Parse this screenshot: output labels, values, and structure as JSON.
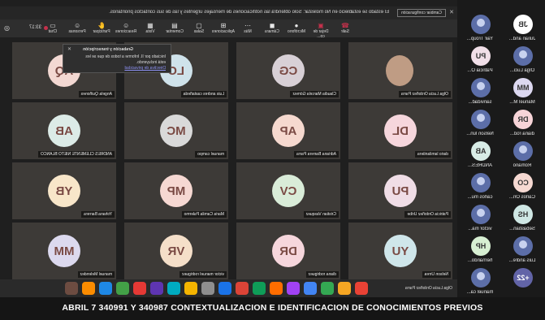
{
  "meeting": {
    "notice": "El estado se estableció en No molestar: Solo obtendrá las notificaciones de mensajes urgentes y las de sus contactos prioritarios.",
    "notice_button": "Cambiar configuración",
    "timer": "33:17"
  },
  "toolbar": {
    "items": [
      {
        "label": "Chat",
        "icon": "chat-icon"
      },
      {
        "label": "Personas",
        "icon": "people-icon"
      },
      {
        "label": "Participar",
        "icon": "raise-hand-icon"
      },
      {
        "label": "Reacciones",
        "icon": "reaction-icon"
      },
      {
        "label": "Vista",
        "icon": "view-icon"
      },
      {
        "label": "Comentar",
        "icon": "notes-icon"
      },
      {
        "label": "Salas",
        "icon": "rooms-icon"
      },
      {
        "label": "Aplicaciones",
        "icon": "apps-icon"
      },
      {
        "label": "Más",
        "icon": "more-icon"
      },
      {
        "label": "Cámara",
        "icon": "camera-icon"
      },
      {
        "label": "Micrófono",
        "icon": "microphone-icon"
      },
      {
        "label": "Dejar de co...",
        "icon": "share-stop-icon"
      },
      {
        "label": "Salir",
        "icon": "leave-icon"
      }
    ]
  },
  "popup": {
    "title": "Grabación y transcripción",
    "line1": "Iniciado por II. Informe a todos de que se les",
    "line2": "está incluyendo.",
    "link": "Directiva de privacidad"
  },
  "roster": [
    {
      "initials": "JB",
      "name": "Julian and..."
    },
    {
      "initials": "",
      "name": "Yair Troup..."
    },
    {
      "initials": "",
      "name": "Olga Luci..."
    },
    {
      "initials": "PU",
      "name": "Patricia O..."
    },
    {
      "initials": "MM",
      "name": "Manuel M..."
    },
    {
      "initials": "",
      "name": "sanvidad..."
    },
    {
      "initials": "DR",
      "name": "diana rod..."
    },
    {
      "initials": "",
      "name": "Nelson lun..."
    },
    {
      "initials": "",
      "name": "Romario"
    },
    {
      "initials": "AB",
      "name": "ANDRES..."
    },
    {
      "initials": "CO",
      "name": "Carlos Ori..."
    },
    {
      "initials": "",
      "name": "carlos mu..."
    },
    {
      "initials": "HS",
      "name": "Sebastian..."
    },
    {
      "initials": "",
      "name": "victor ma..."
    },
    {
      "initials": "",
      "name": "Luis andre..."
    },
    {
      "initials": "HP",
      "name": "hernando..."
    },
    {
      "initials": "+22",
      "name": ""
    },
    {
      "initials": "",
      "name": "manuel ca..."
    }
  ],
  "tiles": [
    {
      "initials": "",
      "name": "Olga Lucia Ordoñez Parra",
      "color": "#c9a28e",
      "photo": true
    },
    {
      "initials": "CG",
      "name": "Claudia Marcela Gómez",
      "color": "#d8d0d6"
    },
    {
      "initials": "LC",
      "name": "Luis andres castañeda",
      "color": "#cfe2ea"
    },
    {
      "initials": "AQ",
      "name": "Angela Quiñones",
      "color": "#f3d8d2"
    },
    {
      "initials": "DL",
      "name": "dario lamilantiera",
      "color": "#f6d6dc"
    },
    {
      "initials": "AP",
      "name": "Adriana Barrera Parra",
      "color": "#f6d9cf"
    },
    {
      "initials": "MC",
      "name": "manuel campo",
      "color": "#d9d9d9"
    },
    {
      "initials": "AB",
      "name": "ANDRES CLEMENTE NIETO BLANCO",
      "color": "#dcebe7"
    },
    {
      "initials": "PU",
      "name": "Patricia Ordoñez Uribe",
      "color": "#f0dde6"
    },
    {
      "initials": "CV",
      "name": "Cristian Vasquez",
      "color": "#d9ecd8"
    },
    {
      "initials": "MP",
      "name": "Maria Camila Palermo",
      "color": "#f6d8d2"
    },
    {
      "initials": "YB",
      "name": "Yohana Barrera",
      "color": "#f8e6c9"
    },
    {
      "initials": "YU",
      "name": "Nelson Urrea",
      "color": "#cfe6ea"
    },
    {
      "initials": "DR",
      "name": "diana rodriguez",
      "color": "#f6d6dc"
    },
    {
      "initials": "VR",
      "name": "victor manuel rodriguez",
      "color": "#f5dfc9"
    },
    {
      "initials": "MM",
      "name": "manuel Melendez",
      "color": "#dcd9ee"
    }
  ],
  "dock": {
    "presenter_label": "Olga Lucia Ordoñez Parra",
    "app_colors": [
      "#e94235",
      "#f6a623",
      "#34a853",
      "#4285f4",
      "#a142f4",
      "#ff6d00",
      "#0f9d58",
      "#db4437",
      "#1a73e8",
      "#8e8e8e",
      "#f4b400",
      "#00acc1",
      "#5e35b1",
      "#e53935",
      "#43a047",
      "#1e88e5",
      "#fb8c00",
      "#6d4c41"
    ]
  },
  "caption": "ABRIL 7 340991 Y 340987 CONTEXTUALIZACION E IDENTIFICACION DE CONOCIMIENTOS PREVIOS",
  "colors": {
    "accent": "#6264a7",
    "record": "#c4314b"
  }
}
